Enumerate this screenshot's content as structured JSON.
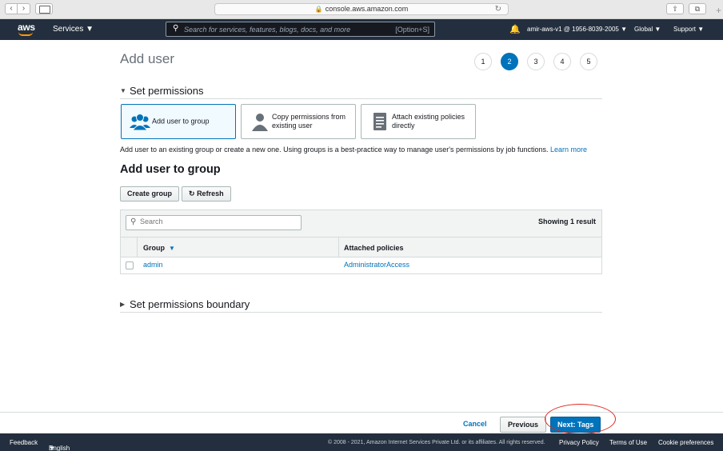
{
  "browser": {
    "url": "console.aws.amazon.com"
  },
  "nav": {
    "logo": "aws",
    "services_label": "Services",
    "search_placeholder": "Search for services, features, blogs, docs, and more",
    "search_shortcut": "[Option+S]",
    "account": "amir-aws-v1 @ 1956-8039-2005",
    "region": "Global",
    "support": "Support"
  },
  "page": {
    "title": "Add user",
    "steps": [
      "1",
      "2",
      "3",
      "4",
      "5"
    ],
    "active_step": "2"
  },
  "permissions": {
    "heading": "Set permissions",
    "options": [
      {
        "label": "Add user to group",
        "selected": true,
        "icon": "group-icon"
      },
      {
        "label": "Copy permissions from existing user",
        "selected": false,
        "icon": "user-icon"
      },
      {
        "label": "Attach existing policies directly",
        "selected": false,
        "icon": "document-icon"
      }
    ],
    "description": "Add user to an existing group or create a new one. Using groups is a best-practice way to manage user's permissions by job functions.",
    "learn_more": "Learn more"
  },
  "group_section": {
    "title": "Add user to group",
    "create_group": "Create group",
    "refresh": "Refresh",
    "search_placeholder": "Search",
    "showing": "Showing 1 result",
    "columns": [
      "Group",
      "Attached policies"
    ],
    "rows": [
      {
        "group": "admin",
        "policies": "AdministratorAccess"
      }
    ]
  },
  "boundary": {
    "heading": "Set permissions boundary"
  },
  "actions": {
    "cancel": "Cancel",
    "previous": "Previous",
    "next": "Next: Tags"
  },
  "footer": {
    "feedback": "Feedback",
    "language": "English (US)",
    "copyright": "© 2008 - 2021, Amazon Internet Services Private Ltd. or its affiliates. All rights reserved.",
    "privacy": "Privacy Policy",
    "terms": "Terms of Use",
    "cookies": "Cookie preferences"
  },
  "colors": {
    "nav_bg": "#232f3e",
    "accent": "#0073bb",
    "highlight": "#e0281e",
    "aws_orange": "#ff9900"
  }
}
